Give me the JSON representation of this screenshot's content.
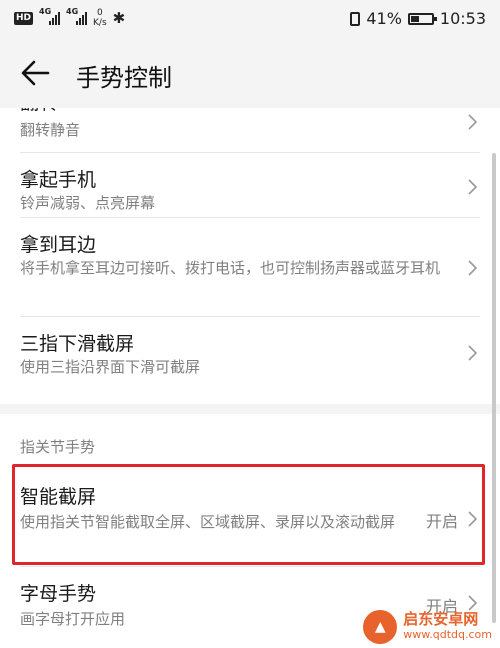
{
  "status_bar": {
    "hd": "HD",
    "sim1": "4G",
    "sim2": "4G",
    "speed_value": "0",
    "speed_unit": "K/s",
    "battery_percent": "41%",
    "battery_level": 0.41,
    "time": "10:53"
  },
  "appbar": {
    "title": "手势控制"
  },
  "items": [
    {
      "title": "翻转",
      "subtitle": "翻转静音"
    },
    {
      "title": "拿起手机",
      "subtitle": "铃声减弱、点亮屏幕"
    },
    {
      "title": "拿到耳边",
      "subtitle": "将手机拿至耳边可接听、拨打电话，也可控制扬声器或蓝牙耳机"
    },
    {
      "title": "三指下滑截屏",
      "subtitle": "使用三指沿界面下滑可截屏"
    }
  ],
  "section2": {
    "header": "指关节手势",
    "items": [
      {
        "title": "智能截屏",
        "subtitle": "使用指关节智能截取全屏、区域截屏、录屏以及滚动截屏",
        "state": "开启"
      },
      {
        "title": "字母手势",
        "subtitle": "画字母打开应用",
        "state": "开启"
      }
    ]
  },
  "watermark": {
    "name": "启东安卓网",
    "url": "www.qdtdq.com"
  },
  "colors": {
    "highlight": "#e0252b",
    "watermark": "#e8632b"
  }
}
